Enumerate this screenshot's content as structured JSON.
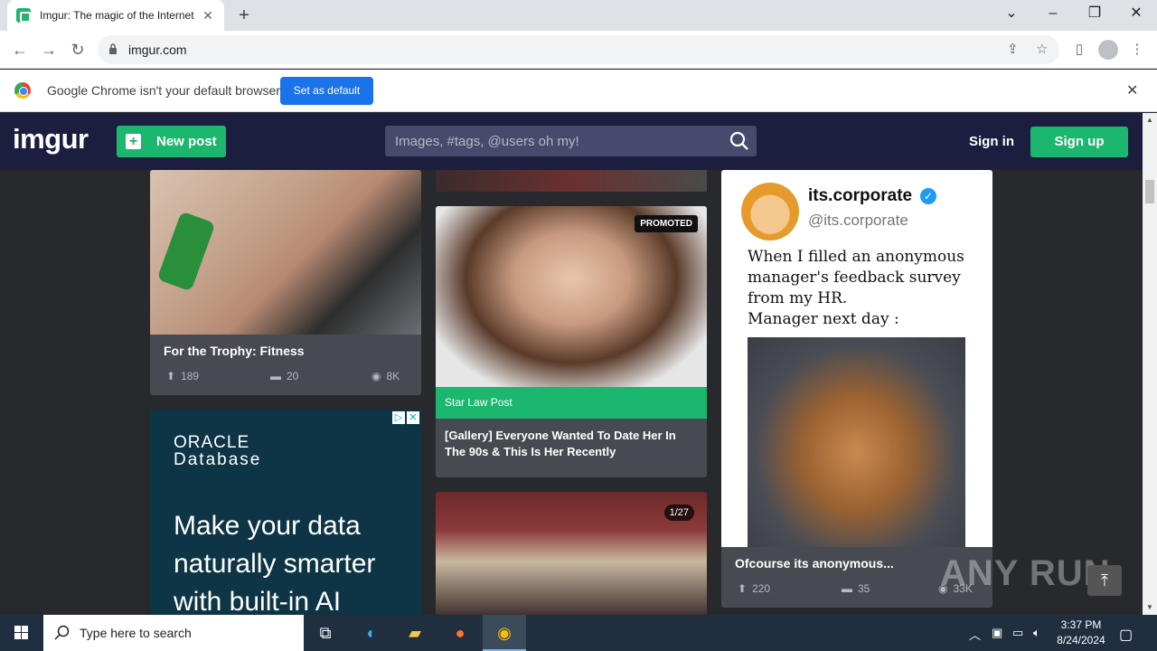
{
  "browser": {
    "tab_title": "Imgur: The magic of the Internet",
    "url": "imgur.com",
    "infobar_message": "Google Chrome isn't your default browser",
    "infobar_button": "Set as default"
  },
  "imgur": {
    "logo": "imgur",
    "new_post": "New post",
    "search_placeholder": "Images, #tags, @users oh my!",
    "sign_in": "Sign in",
    "sign_up": "Sign up"
  },
  "posts": [
    {
      "caption": "For the Trophy: Fitness",
      "upvotes": "189",
      "comments": "20",
      "views": "8K"
    },
    {
      "caption": "Ofcourse its anonymous...",
      "upvotes": "220",
      "comments": "35",
      "views": "33K"
    }
  ],
  "oracle_ad": {
    "brand_line1": "ORACLE",
    "brand_line2": "Database",
    "headline": "Make your data naturally smarter with built-in AI"
  },
  "promoted_post": {
    "badge": "PROMOTED",
    "sponsor": "Star Law Post",
    "title": "[Gallery] Everyone Wanted To Date Her In The 90s & This Is Her Recently"
  },
  "gallery_post": {
    "counter": "1/27"
  },
  "tweet": {
    "name": "its.corporate",
    "handle": "@its.corporate",
    "text_lines": [
      "When I filled an anonymous",
      "manager's feedback survey",
      "from my HR.",
      "Manager next day :"
    ]
  },
  "watermark": "ANY RUN",
  "taskbar": {
    "search_placeholder": "Type here to search",
    "time": "3:37 PM",
    "date": "8/24/2024"
  },
  "colors": {
    "imgur_header": "#1c1e40",
    "imgur_green": "#1bb76e",
    "page_bg": "#27292d",
    "chrome_blue": "#1a73e8"
  }
}
